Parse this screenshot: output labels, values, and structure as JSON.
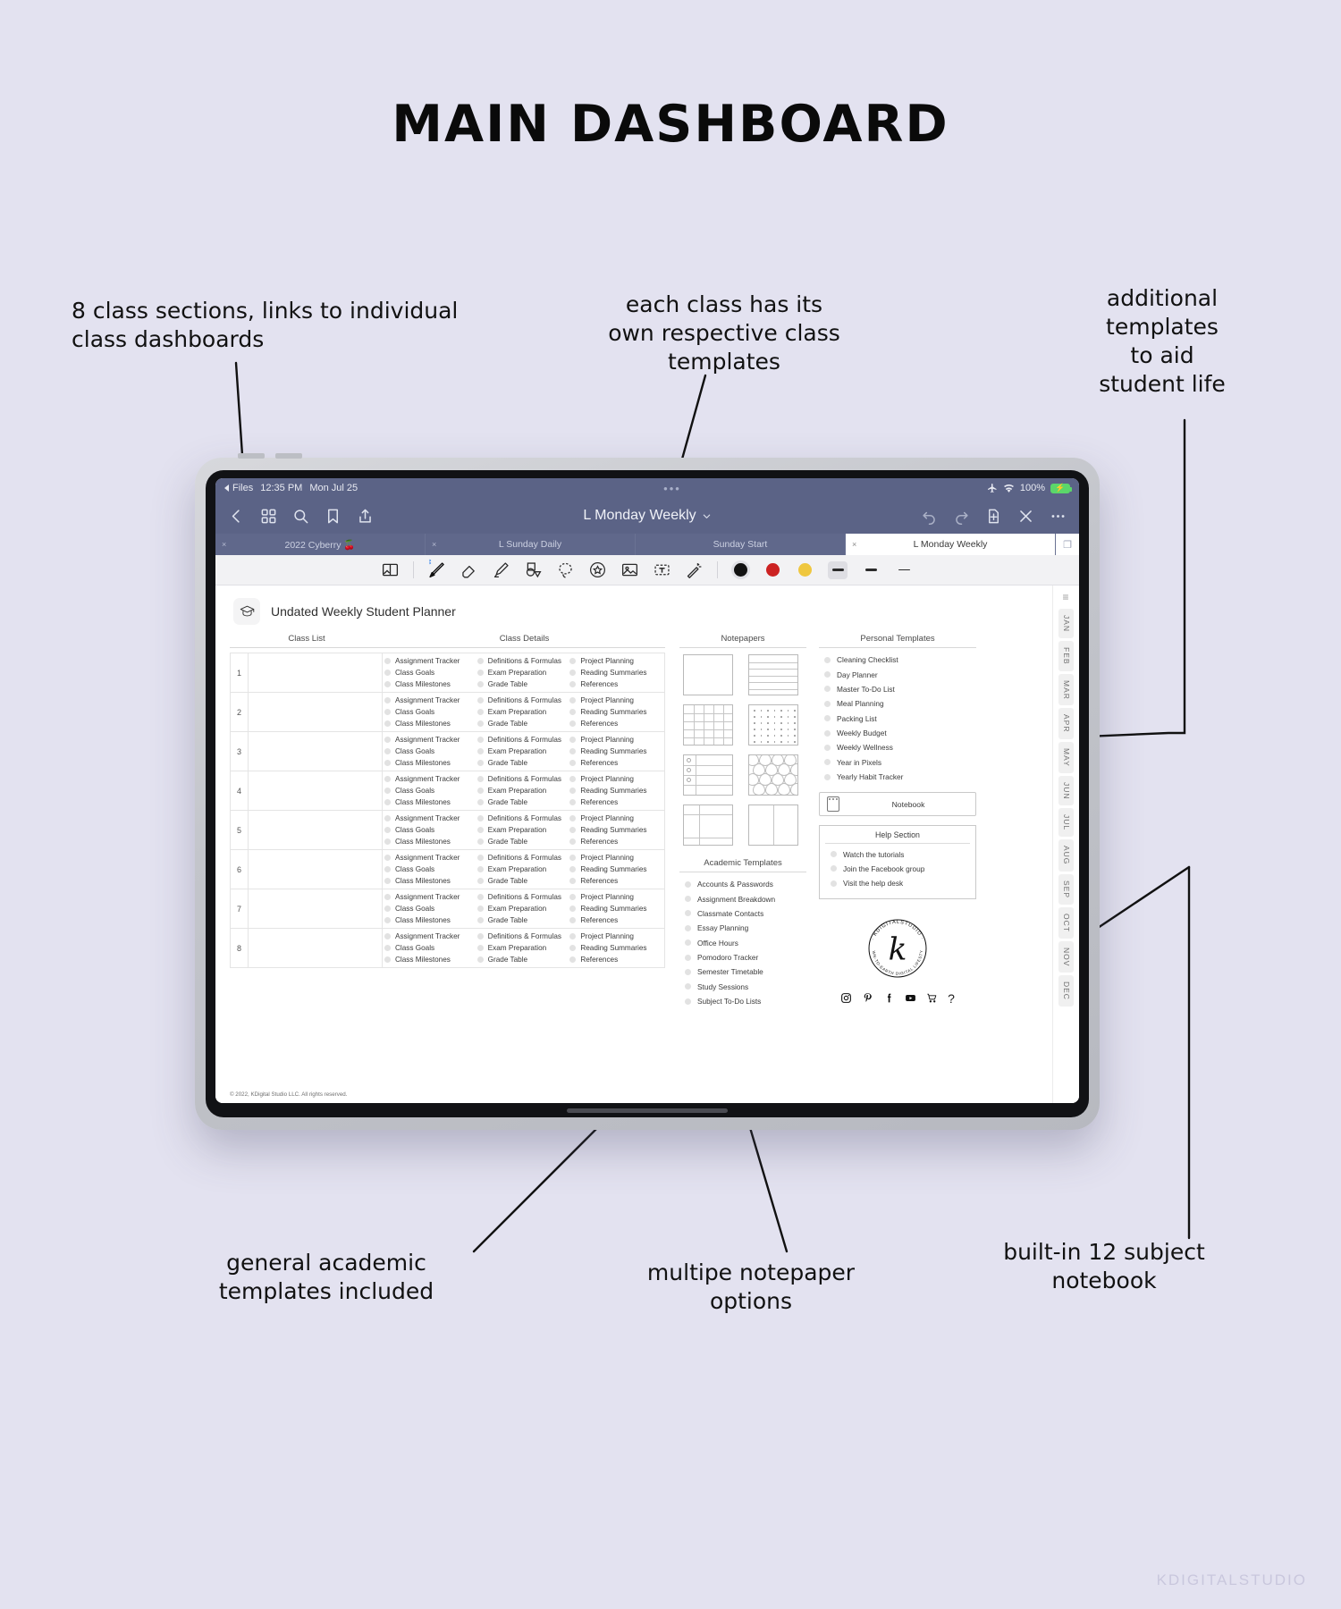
{
  "page": {
    "title": "MAIN DASHBOARD",
    "watermark": "KDIGITALSTUDIO",
    "background_color": "#e3e2f0"
  },
  "annotations": [
    {
      "id": "classes",
      "text": "8 class sections, links to individual\nclass dashboards"
    },
    {
      "id": "templates",
      "text": "each class has its\nown respective class\ntemplates"
    },
    {
      "id": "additional",
      "text": "additional\ntemplates\nto aid\nstudent life"
    },
    {
      "id": "academic",
      "text": "general academic\ntemplates included"
    },
    {
      "id": "notepaper",
      "text": "multipe notepaper\noptions"
    },
    {
      "id": "notebook",
      "text": "built-in 12 subject\nnotebook"
    }
  ],
  "device": {
    "statusbar": {
      "back_app": "Files",
      "time": "12:35 PM",
      "date": "Mon Jul 25",
      "handle": "•••",
      "airplane_icon": "airplane-icon",
      "wifi_icon": "wifi-icon",
      "battery_percent": "100%",
      "battery_state": "charging"
    },
    "navbar": {
      "back_icon": "chevron-left-icon",
      "grid_icon": "thumbnails-grid-icon",
      "search_icon": "search-icon",
      "bookmark_icon": "bookmark-icon",
      "share_icon": "share-icon",
      "document_title": "L Monday Weekly",
      "title_chevron": "chevron-down-icon",
      "undo_icon": "undo-icon",
      "redo_icon": "redo-icon",
      "add_page_icon": "add-page-icon",
      "close_icon": "close-icon",
      "more_icon": "more-options-icon"
    },
    "tabs": [
      {
        "label": "2022 Cyberry 🍒",
        "active": false
      },
      {
        "label": "L Sunday Daily",
        "active": false
      },
      {
        "label": "Sunday Start",
        "active": false
      },
      {
        "label": "L Monday Weekly",
        "active": true
      }
    ],
    "toolbar": {
      "tools": [
        {
          "name": "page-layout-icon",
          "selected": false
        },
        {
          "name": "pen-icon",
          "selected": true
        },
        {
          "name": "eraser-icon",
          "selected": false
        },
        {
          "name": "highlighter-icon",
          "selected": false
        },
        {
          "name": "shapes-icon",
          "selected": false
        },
        {
          "name": "lasso-icon",
          "selected": false
        },
        {
          "name": "sticker-icon",
          "selected": false
        },
        {
          "name": "image-icon",
          "selected": false
        },
        {
          "name": "text-box-icon",
          "selected": false
        },
        {
          "name": "magic-wand-icon",
          "selected": false
        }
      ],
      "colors": [
        {
          "name": "color-black",
          "hex": "#111111",
          "selected": true
        },
        {
          "name": "color-red",
          "hex": "#cc2222",
          "selected": false
        },
        {
          "name": "color-yellow",
          "hex": "#efc73f",
          "selected": false
        }
      ],
      "widths": [
        {
          "name": "stroke-width-thick",
          "selected": true
        },
        {
          "name": "stroke-width-medium",
          "selected": false
        },
        {
          "name": "stroke-width-thin",
          "selected": false
        }
      ]
    }
  },
  "planner": {
    "doc_icon": "graduation-cap-icon",
    "doc_title": "Undated Weekly Student Planner",
    "copyright": "© 2022, KDigital Studio LLC. All rights reserved.",
    "headers": {
      "class_list": "Class List",
      "class_details": "Class Details",
      "notepapers": "Notepapers",
      "personal_templates": "Personal Templates",
      "academic_templates": "Academic Templates",
      "help_section": "Help Section"
    },
    "class_rows": [
      "1",
      "2",
      "3",
      "4",
      "5",
      "6",
      "7",
      "8"
    ],
    "class_detail_links": [
      "Assignment Tracker",
      "Definitions & Formulas",
      "Project Planning",
      "Class Goals",
      "Exam Preparation",
      "Reading Summaries",
      "Class Milestones",
      "Grade Table",
      "References"
    ],
    "notepapers": [
      {
        "name": "blank-paper",
        "style": "blank"
      },
      {
        "name": "lined-paper",
        "style": "lined"
      },
      {
        "name": "grid-paper",
        "style": "grid"
      },
      {
        "name": "dotted-paper",
        "style": "dotted"
      },
      {
        "name": "checklist-paper",
        "style": "checklist"
      },
      {
        "name": "hex-paper",
        "style": "hex"
      },
      {
        "name": "cornell-paper",
        "style": "cornell"
      },
      {
        "name": "split-paper",
        "style": "split"
      }
    ],
    "personal_templates": [
      "Cleaning Checklist",
      "Day Planner",
      "Master To-Do List",
      "Meal Planning",
      "Packing List",
      "Weekly Budget",
      "Weekly Wellness",
      "Year in Pixels",
      "Yearly Habit Tracker"
    ],
    "academic_templates": [
      "Accounts & Passwords",
      "Assignment Breakdown",
      "Classmate Contacts",
      "Essay Planning",
      "Office Hours",
      "Pomodoro Tracker",
      "Semester Timetable",
      "Study Sessions",
      "Subject To-Do Lists"
    ],
    "notebook_label": "Notebook",
    "notebook_icon": "notebook-icon",
    "help_items": [
      "Watch the tutorials",
      "Join the Facebook group",
      "Visit the help desk"
    ],
    "brand": {
      "seal_top": "KDIGITALSTUDIO",
      "seal_bottom": "DOWN-TO-EARTH DIGITAL LIFESTYLE",
      "seal_letter": "k",
      "socials": [
        "instagram-icon",
        "pinterest-icon",
        "facebook-icon",
        "youtube-icon",
        "shop-icon",
        "question-icon"
      ]
    },
    "months": [
      "JAN",
      "FEB",
      "MAR",
      "APR",
      "MAY",
      "JUN",
      "JUL",
      "AUG",
      "SEP",
      "OCT",
      "NOV",
      "DEC"
    ],
    "rail_menu_icon": "hamburger-icon"
  }
}
